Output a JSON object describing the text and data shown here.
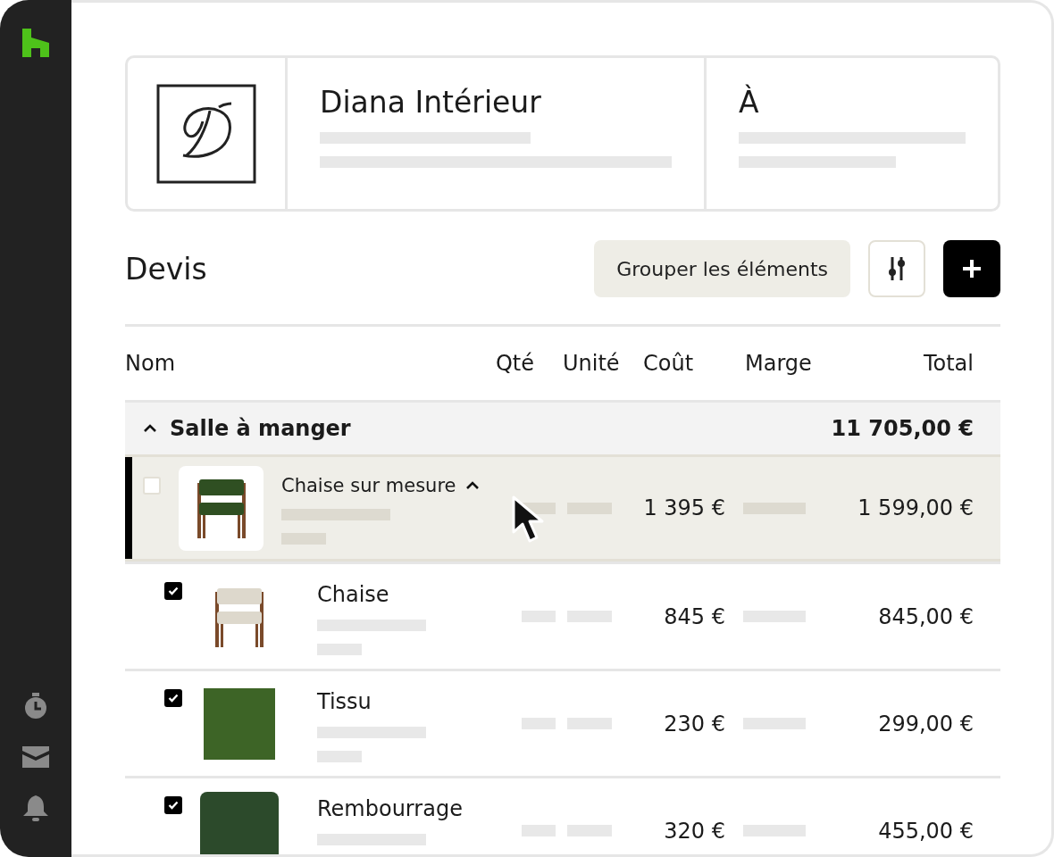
{
  "header": {
    "company_name": "Diana Intérieur",
    "recipient_label": "À"
  },
  "quote": {
    "title": "Devis",
    "group_button": "Grouper les éléments"
  },
  "table": {
    "columns": [
      "Nom",
      "Qté",
      "Unité",
      "Coût",
      "Marge",
      "Total"
    ],
    "groups": [
      {
        "name": "Salle à manger",
        "total": "11 705,00 €",
        "expanded": true,
        "rows": [
          {
            "name": "Chaise sur mesure",
            "kind": "chair-green",
            "checked": false,
            "selected": true,
            "expanded": true,
            "cost": "1 395 €",
            "total": "1 599,00 €",
            "children": [
              {
                "name": "Chaise",
                "kind": "chair-beige",
                "checked": true,
                "selected": false,
                "cost": "845 €",
                "total": "845,00 €"
              },
              {
                "name": "Tissu",
                "kind": "swatch",
                "checked": true,
                "selected": false,
                "cost": "230 €",
                "total": "299,00 €"
              },
              {
                "name": "Rembourrage",
                "kind": "tufted",
                "checked": true,
                "selected": false,
                "cost": "320 €",
                "total": "455,00 €"
              }
            ]
          }
        ]
      }
    ]
  }
}
